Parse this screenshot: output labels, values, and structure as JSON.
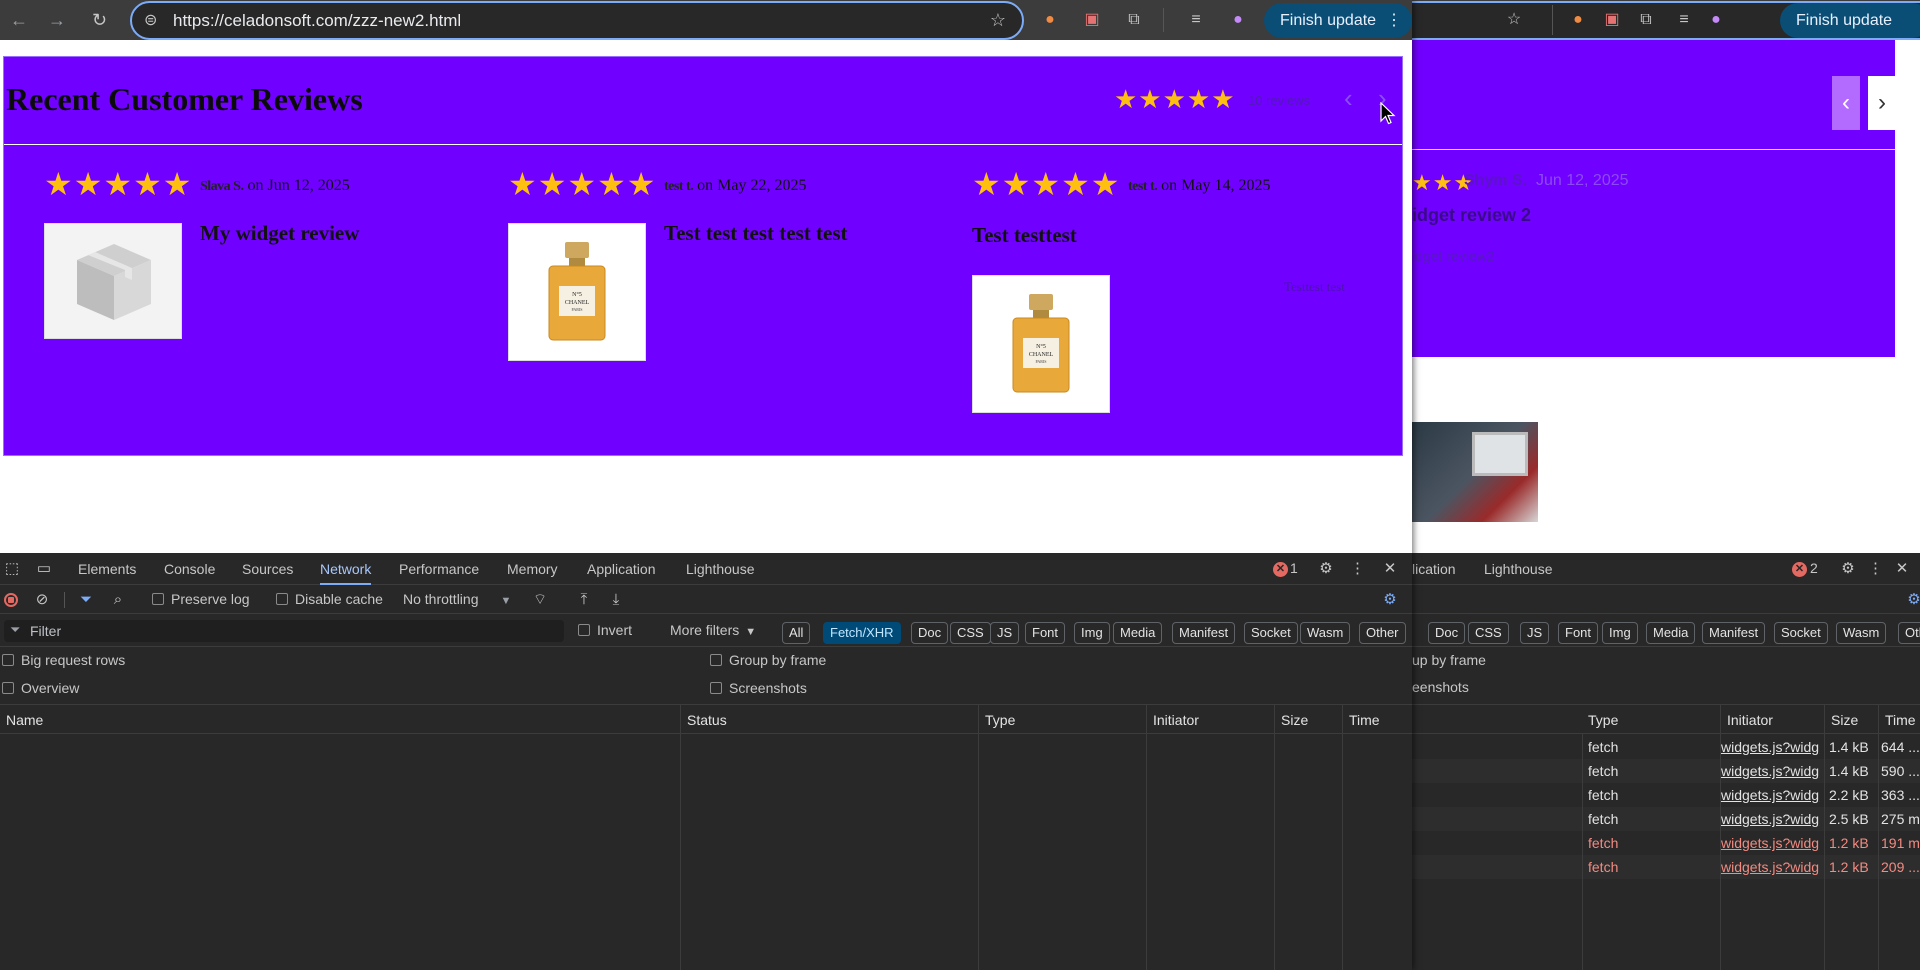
{
  "window_a": {
    "url": "https://celadonsoft.com/zzz-new2.html",
    "finish_update": "Finish update",
    "widget": {
      "title": "Recent Customer Reviews",
      "rating_stars": "★★★★★",
      "reviews_count": "10 reviews",
      "prev_arrow": "‹",
      "next_arrow": "›"
    },
    "reviews": [
      {
        "stars": "★★★★★",
        "author": "Slava S.",
        "date": "on Jun 12, 2025",
        "title": "My widget review",
        "image": "box",
        "body": ""
      },
      {
        "stars": "★★★★★",
        "author": "test t.",
        "date": "on May 22, 2025",
        "title": "Test test test test test",
        "image": "perfume",
        "body": ""
      },
      {
        "stars": "★★★★★",
        "author": "test t.",
        "date": "on May 14, 2025",
        "title": "Test testtest",
        "image": "perfume",
        "body": "Testtest test"
      }
    ],
    "perfume_label": [
      "N°5",
      "CHANEL",
      "PARIS"
    ],
    "devtools": {
      "tabs": [
        "Elements",
        "Console",
        "Sources",
        "Network",
        "Performance",
        "Memory",
        "Application",
        "Lighthouse"
      ],
      "active_tab": "Network",
      "error_count": "1",
      "preserve_log": "Preserve log",
      "disable_cache": "Disable cache",
      "throttling": "No throttling",
      "filter_placeholder": "Filter",
      "invert": "Invert",
      "more_filters": "More filters",
      "chips": [
        "All",
        "Fetch/XHR",
        "Doc",
        "CSS",
        "JS",
        "Font",
        "Img",
        "Media",
        "Manifest",
        "Socket",
        "Wasm",
        "Other"
      ],
      "active_chip": "Fetch/XHR",
      "big_request_rows": "Big request rows",
      "group_by_frame": "Group by frame",
      "overview": "Overview",
      "screenshots": "Screenshots",
      "columns": [
        "Name",
        "Status",
        "Type",
        "Initiator",
        "Size",
        "Time"
      ]
    }
  },
  "window_b": {
    "finish_update": "Finish update",
    "prev_arrow": "‹",
    "next_arrow": "›",
    "review": {
      "stars": "★★★",
      "author": "Shym S.",
      "date": "Jun 12, 2025",
      "title": "idget review 2",
      "body": "idget review2"
    },
    "devtools": {
      "tabs": [
        "lication",
        "Lighthouse"
      ],
      "error_count": "2",
      "chips": [
        "Doc",
        "CSS",
        "JS",
        "Font",
        "Img",
        "Media",
        "Manifest",
        "Socket",
        "Wasm",
        "Other"
      ],
      "group_by_frame": "up by frame",
      "screenshots": "eenshots",
      "columns": [
        "Type",
        "Initiator",
        "Size",
        "Time"
      ],
      "rows": [
        {
          "type": "fetch",
          "initiator": "widgets.js?widg",
          "size": "1.4 kB",
          "time": "644 ...",
          "error": false
        },
        {
          "type": "fetch",
          "initiator": "widgets.js?widg",
          "size": "1.4 kB",
          "time": "590 ...",
          "error": false
        },
        {
          "type": "fetch",
          "initiator": "widgets.js?widg",
          "size": "2.2 kB",
          "time": "363 ...",
          "error": false
        },
        {
          "type": "fetch",
          "initiator": "widgets.js?widg",
          "size": "2.5 kB",
          "time": "275 m",
          "error": false
        },
        {
          "type": "fetch",
          "initiator": "widgets.js?widg",
          "size": "1.2 kB",
          "time": "191 m",
          "error": true
        },
        {
          "type": "fetch",
          "initiator": "widgets.js?widg",
          "size": "1.2 kB",
          "time": "209 ...",
          "error": true
        }
      ]
    }
  },
  "colors": {
    "widget_bg": "#7000ff",
    "star": "#ffbf10",
    "devtools_bg": "#282828",
    "accent": "#7cacf8",
    "error": "#f28b82"
  }
}
